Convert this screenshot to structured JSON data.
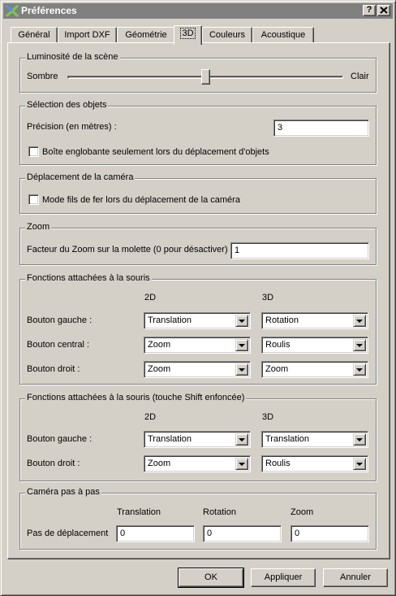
{
  "window": {
    "title": "Préférences",
    "help_btn": "?",
    "close_btn": "✕"
  },
  "tabs": [
    "Général",
    "Import DXF",
    "Géométrie",
    "3D",
    "Couleurs",
    "Acoustique"
  ],
  "active_tab": "3D",
  "luminosity": {
    "title": "Luminosité de la scène",
    "left_label": "Sombre",
    "right_label": "Clair",
    "level": 0.5
  },
  "selection": {
    "title": "Sélection des objets",
    "precision_label": "Précision (en mètres) :",
    "precision_value": "3",
    "bbox_checkbox_label": "Boîte englobante seulement lors du déplacement d'objets",
    "bbox_checked": false
  },
  "camera_move": {
    "title": "Déplacement de la caméra",
    "wireframe_label": "Mode fils de fer lors du déplacement de la caméra",
    "wireframe_checked": false
  },
  "zoom": {
    "title": "Zoom",
    "factor_label": "Facteur du Zoom sur la molette (0 pour désactiver)",
    "factor_value": "1"
  },
  "mouse": {
    "title": "Fonctions attachées à la souris",
    "col_2d": "2D",
    "col_3d": "3D",
    "rows": [
      {
        "label": "Bouton gauche  :",
        "v2d": "Translation",
        "v3d": "Rotation"
      },
      {
        "label": "Bouton central :",
        "v2d": "Zoom",
        "v3d": "Roulis"
      },
      {
        "label": "Bouton droit  :",
        "v2d": "Zoom",
        "v3d": "Zoom"
      }
    ]
  },
  "mouse_shift": {
    "title": "Fonctions attachées à la souris (touche Shift enfoncée)",
    "col_2d": "2D",
    "col_3d": "3D",
    "rows": [
      {
        "label": "Bouton gauche  :",
        "v2d": "Translation",
        "v3d": "Translation"
      },
      {
        "label": "Bouton droit  :",
        "v2d": "Zoom",
        "v3d": "Roulis"
      }
    ]
  },
  "stepper": {
    "title": "Caméra pas à pas",
    "col_translation": "Translation",
    "col_rotation": "Rotation",
    "col_zoom": "Zoom",
    "row_label": "Pas de déplacement",
    "translation_value": "0",
    "rotation_value": "0",
    "zoom_value": "0"
  },
  "buttons": {
    "ok": "OK",
    "apply": "Appliquer",
    "cancel": "Annuler"
  }
}
